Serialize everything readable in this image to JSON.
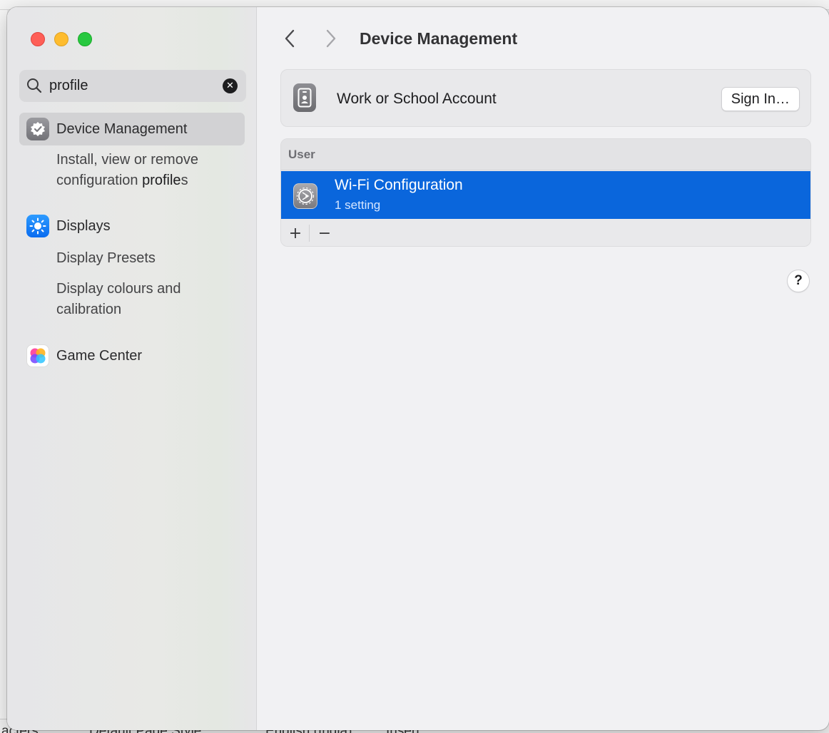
{
  "background_app": {
    "status_items": [
      "acters",
      "Default Page Style",
      "English (India)",
      "Insert"
    ]
  },
  "sidebar": {
    "search": {
      "value": "profile",
      "clear_icon": "clear-icon"
    },
    "items": [
      {
        "label": "Device Management",
        "icon": "device-management-icon",
        "selected": true,
        "sub_prefix": "Install, view or remove configuration ",
        "sub_highlight": "profile",
        "sub_suffix": "s"
      },
      {
        "label": "Displays",
        "icon": "displays-icon",
        "selected": false,
        "subs": [
          "Display Presets",
          "Display colours and calibration"
        ]
      },
      {
        "label": "Game Center",
        "icon": "game-center-icon",
        "selected": false
      }
    ]
  },
  "header": {
    "title": "Device Management",
    "back_icon": "chevron-left-icon",
    "forward_icon": "chevron-right-icon"
  },
  "account": {
    "label": "Work or School Account",
    "button": "Sign In…"
  },
  "profiles": {
    "section": "User",
    "rows": [
      {
        "name": "Wi-Fi Configuration",
        "detail": "1 setting",
        "selected": true
      }
    ],
    "add_label": "+",
    "remove_label": "−"
  },
  "help_label": "?",
  "colors": {
    "selection_blue": "#0a66dc",
    "traffic_red": "#fe5f57",
    "traffic_yellow": "#febc2e",
    "traffic_green": "#28c840"
  }
}
